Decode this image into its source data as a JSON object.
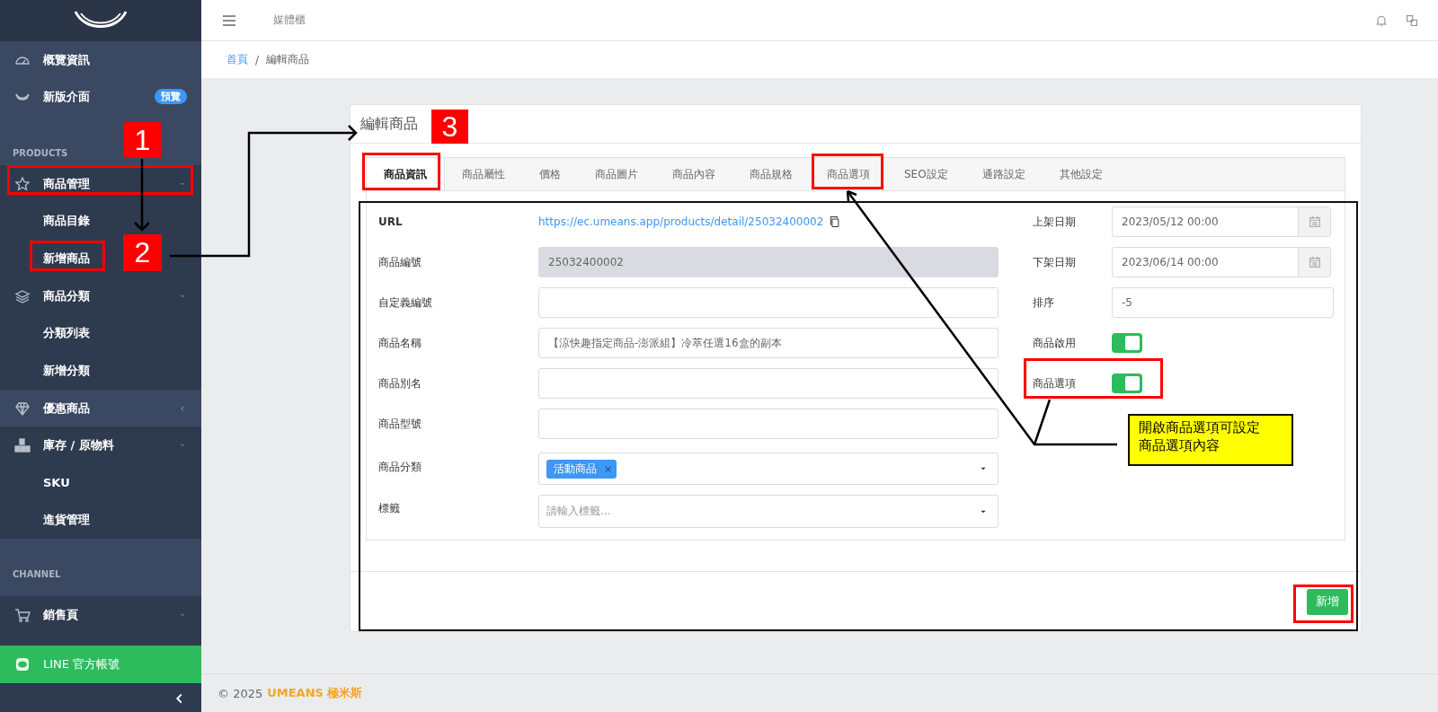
{
  "sidebar": {
    "items": [
      {
        "kind": "item",
        "label": "概覽資訊"
      },
      {
        "kind": "item",
        "label": "新版介面",
        "badge": "預覽"
      },
      {
        "kind": "section",
        "label": "PRODUCTS"
      },
      {
        "kind": "item",
        "label": "商品管理",
        "expanded": true,
        "highlighted": false
      },
      {
        "kind": "subitem",
        "label": "商品目錄"
      },
      {
        "kind": "subitem",
        "label": "新增商品"
      },
      {
        "kind": "item",
        "label": "商品分類",
        "expanded": true,
        "highlighted": false
      },
      {
        "kind": "subitem",
        "label": "分類列表"
      },
      {
        "kind": "subitem",
        "label": "新增分類"
      },
      {
        "kind": "item",
        "label": "優惠商品",
        "expanded": false,
        "highlighted": true
      },
      {
        "kind": "item",
        "label": "庫存 / 原物料",
        "expanded": true,
        "highlighted": false
      },
      {
        "kind": "subitem",
        "label": "SKU"
      },
      {
        "kind": "subitem",
        "label": "進貨管理"
      },
      {
        "kind": "section",
        "label": "CHANNEL"
      },
      {
        "kind": "item",
        "label": "銷售頁",
        "expanded": true,
        "highlighted": false
      },
      {
        "kind": "line",
        "label": "LINE 官方帳號"
      }
    ]
  },
  "header": {
    "title": "媒體櫃"
  },
  "breadcrumb": {
    "items": [
      {
        "label": "首頁",
        "link": true
      },
      {
        "label": "編輯商品",
        "link": false
      }
    ],
    "separator": "/"
  },
  "card": {
    "title": "編輯商品",
    "tabs": [
      {
        "label": "商品資訊",
        "selected": true
      },
      {
        "label": "商品屬性",
        "selected": false
      },
      {
        "label": "價格",
        "selected": false
      },
      {
        "label": "商品圖片",
        "selected": false
      },
      {
        "label": "商品內容",
        "selected": false
      },
      {
        "label": "商品規格",
        "selected": false
      },
      {
        "label": "商品選項",
        "selected": false
      },
      {
        "label": "SEO設定",
        "selected": false
      },
      {
        "label": "通路設定",
        "selected": false
      },
      {
        "label": "其他設定",
        "selected": false
      }
    ],
    "left_fields": [
      {
        "kind": "link",
        "label": "URL",
        "value": "https://ec.umeans.app/products/detail/25032400002"
      },
      {
        "kind": "input",
        "label": "商品編號",
        "value": "25032400002",
        "disabled": true
      },
      {
        "kind": "input",
        "label": "自定義編號",
        "disabled": false
      },
      {
        "kind": "input",
        "label": "商品名稱",
        "value": "【涼快趣指定商品-澎派組】冷萃任選16盒的副本",
        "disabled": false
      },
      {
        "kind": "input",
        "label": "商品別名",
        "disabled": false
      },
      {
        "kind": "input",
        "label": "商品型號",
        "disabled": false
      },
      {
        "kind": "tags",
        "label": "商品分類",
        "tags": [
          {
            "label": "活動商品",
            "remove": "×"
          }
        ]
      },
      {
        "kind": "tags",
        "label": "標籤",
        "placeholder": "請輸入標籤..."
      }
    ],
    "right_fields": [
      {
        "kind": "date",
        "label": "上架日期",
        "value": "2023/05/12 00:00"
      },
      {
        "kind": "date",
        "label": "下架日期",
        "value": "2023/06/14 00:00"
      },
      {
        "kind": "input",
        "label": "排序",
        "value": "-5"
      },
      {
        "kind": "switch",
        "label": "商品啟用",
        "on": true
      },
      {
        "kind": "switch",
        "label": "商品選項",
        "on": true
      }
    ],
    "submit": "新增"
  },
  "footer": {
    "copyright": "© 2025",
    "brand": "UMEANS 極米斯"
  },
  "annotations": {
    "badges": [
      "1",
      "2",
      "3"
    ],
    "callout": [
      "開啟商品選項可設定",
      "商品選項內容"
    ]
  }
}
